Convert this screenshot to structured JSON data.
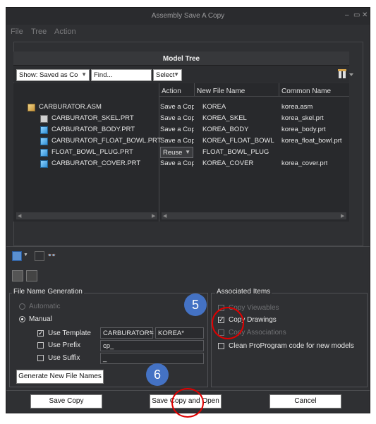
{
  "window": {
    "title": "Assembly Save A Copy",
    "controls": {
      "minimize": "–",
      "restore": "▭",
      "close": "✕"
    }
  },
  "menu": [
    "File",
    "Tree",
    "Action"
  ],
  "model_tree": {
    "title": "Model Tree",
    "show_select": "Show: Saved as Co",
    "find_placeholder": "Find...",
    "select_label": "Select",
    "columns": [
      "Action",
      "New File Name",
      "Common Name"
    ],
    "rows": [
      {
        "name": "CARBURATOR.ASM",
        "icon": "assembly-icon",
        "action": "Save a Copy",
        "new_name": "KOREA",
        "common": "korea.asm"
      },
      {
        "name": "CARBURATOR_SKEL.PRT",
        "icon": "skeleton-icon",
        "action": "Save a Copy",
        "new_name": "KOREA_SKEL",
        "common": "korea_skel.prt"
      },
      {
        "name": "CARBURATOR_BODY.PRT",
        "icon": "part-icon",
        "action": "Save a Copy",
        "new_name": "KOREA_BODY",
        "common": "korea_body.prt"
      },
      {
        "name": "CARBURATOR_FLOAT_BOWL.PRT",
        "icon": "part-icon",
        "action": "Save a Copy",
        "new_name": "KOREA_FLOAT_BOWL",
        "common": "korea_float_bowl.prt"
      },
      {
        "name": "FLOAT_BOWL_PLUG.PRT",
        "icon": "part-icon",
        "action": "Reuse",
        "new_name": "FLOAT_BOWL_PLUG",
        "common": ""
      },
      {
        "name": "CARBURATOR_COVER.PRT",
        "icon": "part-icon",
        "action": "Save a Copy",
        "new_name": "KOREA_COVER",
        "common": "korea_cover.prt"
      }
    ]
  },
  "file_name_generation": {
    "legend": "File Name Generation",
    "automatic": "Automatic",
    "manual": "Manual",
    "use_template": "Use Template",
    "template_from": "CARBURATOR*",
    "equals": "=",
    "template_to": "KOREA*",
    "use_prefix": "Use Prefix",
    "prefix_value": "cp_",
    "use_suffix": "Use Suffix",
    "suffix_value": "_",
    "generate_button": "Generate New File Names"
  },
  "associated_items": {
    "legend": "Associated Items",
    "copy_viewables": "Copy Viewables",
    "copy_drawings": "Copy Drawings",
    "copy_associations": "Copy Associations",
    "clean_proprogram": "Clean ProProgram code for new models"
  },
  "buttons": {
    "save_copy": "Save Copy",
    "save_copy_open": "Save Copy and Open",
    "cancel": "Cancel"
  },
  "annotations": {
    "step5": "5",
    "step6": "6"
  },
  "colors": {
    "window_bg": "#2f3033",
    "marker_blue": "#4472c4",
    "highlight_red": "#e00000"
  }
}
